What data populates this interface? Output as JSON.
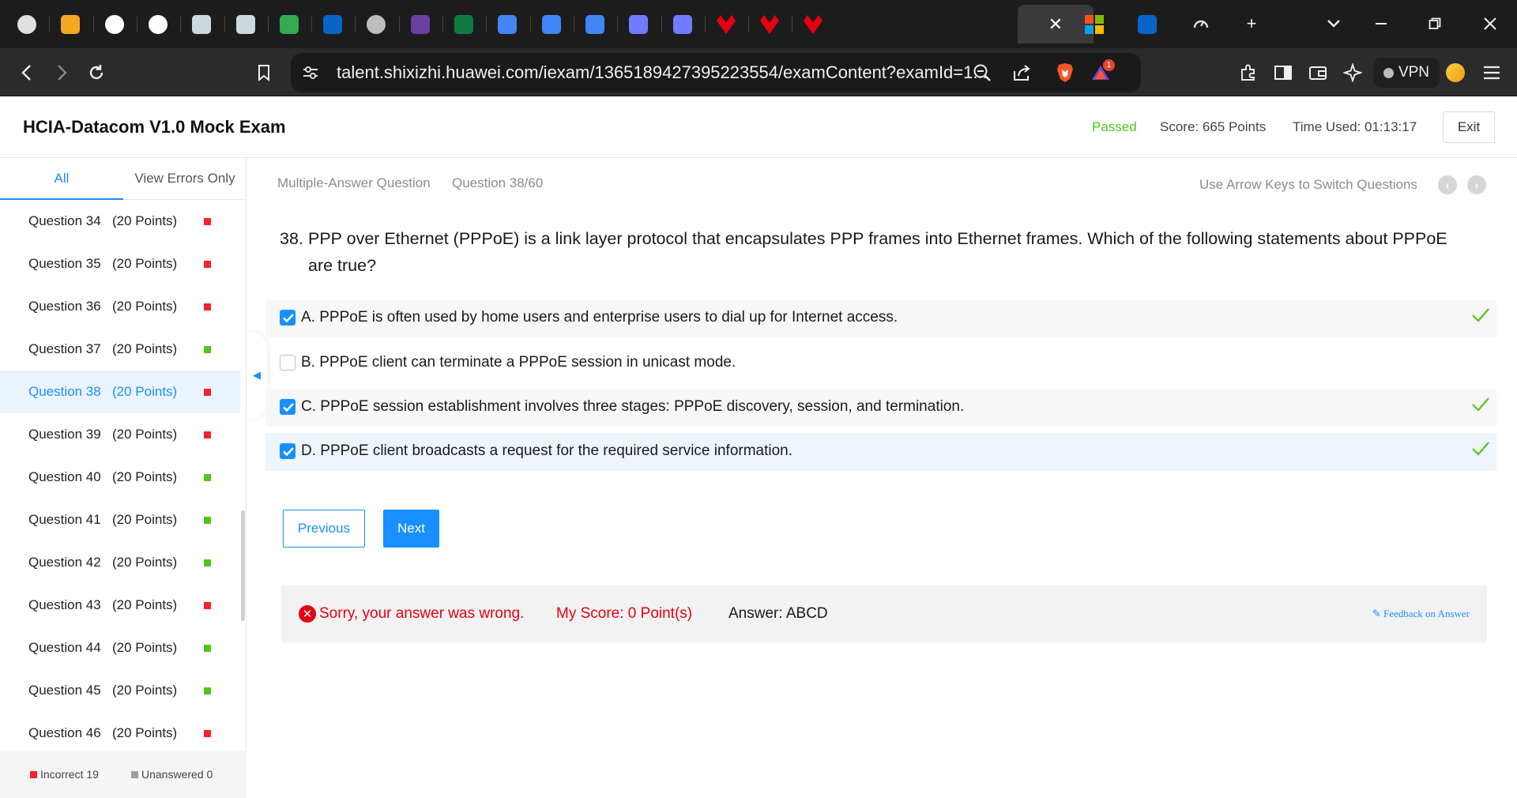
{
  "browser": {
    "url": "talent.shixizhi.huawei.com/iexam/1365189427395223554/examContent?examId=1...",
    "vpn_label": "VPN",
    "alert_count": "1",
    "tabs": [
      {
        "icon": "gauge-icon",
        "color": "#e0e0e0"
      },
      {
        "icon": "co-logo-icon",
        "color": "#f5a623"
      },
      {
        "icon": "six-icon",
        "color": "#ffffff"
      },
      {
        "icon": "six-icon",
        "color": "#ffffff"
      },
      {
        "icon": "mascot-icon",
        "color": "#cfd8dc"
      },
      {
        "icon": "mascot-icon",
        "color": "#cfd8dc"
      },
      {
        "icon": "meet-icon",
        "color": "#34a853"
      },
      {
        "icon": "outlook-icon",
        "color": "#0a64c8"
      },
      {
        "icon": "globe-icon",
        "color": "#bdbdbd"
      },
      {
        "icon": "emblem-icon",
        "color": "#6a3fa0"
      },
      {
        "icon": "forms-icon",
        "color": "#107c41"
      },
      {
        "icon": "docs-icon",
        "color": "#4285f4"
      },
      {
        "icon": "docs-icon",
        "color": "#4285f4"
      },
      {
        "icon": "docs-icon",
        "color": "#4285f4"
      },
      {
        "icon": "bird-icon",
        "color": "#6f7cff"
      },
      {
        "icon": "bird-icon",
        "color": "#6f7cff"
      },
      {
        "icon": "huawei-icon",
        "color": "#e60012"
      },
      {
        "icon": "huawei-icon",
        "color": "#e60012"
      },
      {
        "icon": "huawei-icon",
        "color": "#e60012"
      }
    ]
  },
  "exam": {
    "title": "HCIA-Datacom V1.0 Mock Exam",
    "status": "Passed",
    "score_label": "Score:",
    "score_value": "665 Points",
    "time_label": "Time Used:",
    "time_value": "01:13:17",
    "exit_label": "Exit"
  },
  "sidebar": {
    "tab_all": "All",
    "tab_errors": "View Errors Only",
    "questions": [
      {
        "name": "Question 34",
        "points": "(20 Points)",
        "status": "incorrect"
      },
      {
        "name": "Question 35",
        "points": "(20 Points)",
        "status": "incorrect"
      },
      {
        "name": "Question 36",
        "points": "(20 Points)",
        "status": "incorrect"
      },
      {
        "name": "Question 37",
        "points": "(20 Points)",
        "status": "correct"
      },
      {
        "name": "Question 38",
        "points": "(20 Points)",
        "status": "incorrect",
        "current": true
      },
      {
        "name": "Question 39",
        "points": "(20 Points)",
        "status": "incorrect"
      },
      {
        "name": "Question 40",
        "points": "(20 Points)",
        "status": "correct"
      },
      {
        "name": "Question 41",
        "points": "(20 Points)",
        "status": "correct"
      },
      {
        "name": "Question 42",
        "points": "(20 Points)",
        "status": "correct"
      },
      {
        "name": "Question 43",
        "points": "(20 Points)",
        "status": "incorrect"
      },
      {
        "name": "Question 44",
        "points": "(20 Points)",
        "status": "correct"
      },
      {
        "name": "Question 45",
        "points": "(20 Points)",
        "status": "correct"
      },
      {
        "name": "Question 46",
        "points": "(20 Points)",
        "status": "incorrect"
      }
    ],
    "legend_incorrect": "Incorrect 19",
    "legend_unanswered": "Unanswered 0",
    "colors": {
      "incorrect": "#f5222d",
      "correct": "#52c41a",
      "unanswered": "#9e9e9e"
    }
  },
  "main": {
    "question_type": "Multiple-Answer Question",
    "question_progress": "Question 38/60",
    "arrow_hint": "Use Arrow Keys to Switch Questions",
    "question_number": "38.",
    "question_text": "PPP over Ethernet (PPPoE) is a link layer protocol that encapsulates PPP frames into Ethernet frames. Which of the following statements about PPPoE are true?",
    "options": [
      {
        "text": "A. PPPoE is often used by home users and enterprise users to dial up for Internet access.",
        "checked": true,
        "correct": true
      },
      {
        "text": "B. PPPoE client can terminate a PPPoE session in unicast mode.",
        "checked": false,
        "correct": false
      },
      {
        "text": "C. PPPoE session establishment involves three stages: PPPoE discovery, session, and termination.",
        "checked": true,
        "correct": true
      },
      {
        "text": "D. PPPoE client broadcasts a request for the required service information.",
        "checked": true,
        "correct": true
      }
    ],
    "prev_label": "Previous",
    "next_label": "Next",
    "result": {
      "wrong_text": "Sorry, your answer was wrong.",
      "my_score": "My Score:  0 Point(s)",
      "answer": "Answer:  ABCD",
      "feedback": "Feedback on Answer"
    },
    "accent_color": "#1890ff"
  }
}
